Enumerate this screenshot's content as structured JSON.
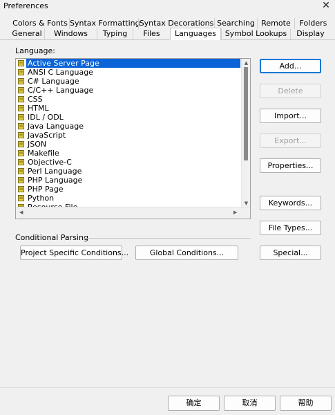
{
  "window": {
    "title": "Preferences",
    "close_glyph": "✕"
  },
  "tabs_row1": [
    "Colors & Fonts",
    "Syntax Formatting",
    "Syntax Decorations",
    "Searching",
    "Remote",
    "Folders"
  ],
  "tabs_row2": [
    "General",
    "Windows",
    "Typing",
    "Files",
    "Languages",
    "Symbol Lookups",
    "Display"
  ],
  "active_tab": "Languages",
  "language_section": {
    "label": "Language:",
    "items": [
      "Active Server Page",
      "ANSI C Language",
      "C# Language",
      "C/C++ Language",
      "CSS",
      "HTML",
      "IDL / ODL",
      "Java Language",
      "JavaScript",
      "JSON",
      "Makefile",
      "Objective-C",
      "Perl Language",
      "PHP Language",
      "PHP Page",
      "Python",
      "Resource File"
    ],
    "selected": "Active Server Page",
    "item_icon": "language-file-icon"
  },
  "side_buttons": {
    "add": "Add...",
    "delete": "Delete",
    "import": "Import...",
    "export": "Export...",
    "properties": "Properties...",
    "keywords": "Keywords...",
    "file_types": "File Types...",
    "special": "Special..."
  },
  "conditional_parsing": {
    "label": "Conditional Parsing",
    "project_button": "Project Specific Conditions...",
    "global_button": "Global Conditions..."
  },
  "footer": {
    "ok": "确定",
    "cancel": "取消",
    "help": "帮助"
  },
  "colors": {
    "selection": "#0a64d8",
    "default_button_border": "#0078d7",
    "icon_yellow": "#e8d44d"
  }
}
